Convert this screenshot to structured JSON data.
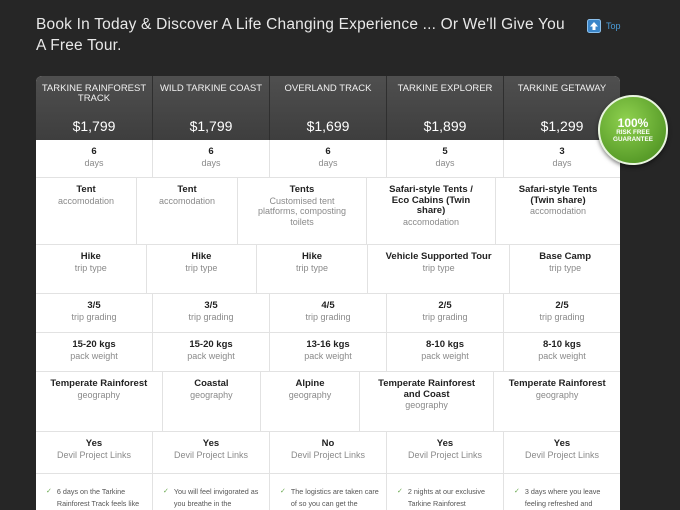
{
  "headline": "Book In Today & Discover A Life Changing Experience ... Or We'll Give You A Free Tour.",
  "top_link": {
    "label": "Top",
    "icon": "up-arrow-icon"
  },
  "badge": {
    "line1": "100%",
    "line2": "RISK FREE",
    "line3": "GUARANTEE",
    "color": "#6ab53a"
  },
  "tours": [
    {
      "name": "Tarkine Rainforest Track",
      "price": "$1,799",
      "days": "6",
      "days_label": "days",
      "accom": "Tent",
      "accom_label": "accomodation",
      "trip_type": "Hike",
      "trip_type_label": "trip type",
      "grading": "3/5",
      "grading_label": "trip grading",
      "pack": "15-20 kgs",
      "pack_label": "pack weight",
      "geography": "Temperate Rainforest",
      "geography_label": "geography",
      "devil": "Yes",
      "devil_label": "Devil Project Links",
      "desc": "6 days on the Tarkine Rainforest Track feels like"
    },
    {
      "name": "Wild Tarkine Coast",
      "price": "$1,799",
      "days": "6",
      "days_label": "days",
      "accom": "Tent",
      "accom_label": "accomodation",
      "trip_type": "Hike",
      "trip_type_label": "trip type",
      "grading": "3/5",
      "grading_label": "trip grading",
      "pack": "15-20 kgs",
      "pack_label": "pack weight",
      "geography": "Coastal",
      "geography_label": "geography",
      "devil": "Yes",
      "devil_label": "Devil Project Links",
      "desc": "You will feel invigorated as you breathe in the"
    },
    {
      "name": "Overland Track",
      "price": "$1,699",
      "days": "6",
      "days_label": "days",
      "accom": "Tents",
      "accom_label": "Customised tent platforms, composting toilets",
      "trip_type": "Hike",
      "trip_type_label": "trip type",
      "grading": "4/5",
      "grading_label": "trip grading",
      "pack": "13-16 kgs",
      "pack_label": "pack weight",
      "geography": "Alpine",
      "geography_label": "geography",
      "devil": "No",
      "devil_label": "Devil Project Links",
      "desc": "The logistics are taken care of so you can get the"
    },
    {
      "name": "Tarkine Explorer",
      "price": "$1,899",
      "days": "5",
      "days_label": "days",
      "accom": "Safari-style Tents / Eco Cabins (Twin share)",
      "accom_label": "accomodation",
      "trip_type": "Vehicle Supported Tour",
      "trip_type_label": "trip type",
      "grading": "2/5",
      "grading_label": "trip grading",
      "pack": "8-10 kgs",
      "pack_label": "pack weight",
      "geography": "Temperate Rainforest and Coast",
      "geography_label": "geography",
      "devil": "Yes",
      "devil_label": "Devil Project Links",
      "desc": "2 nights at our exclusive Tarkine Rainforest"
    },
    {
      "name": "Tarkine Getaway",
      "price": "$1,299",
      "days": "3",
      "days_label": "days",
      "accom": "Safari-style Tents (Twin share)",
      "accom_label": "accomodation",
      "trip_type": "Base Camp",
      "trip_type_label": "trip type",
      "grading": "2/5",
      "grading_label": "trip grading",
      "pack": "8-10 kgs",
      "pack_label": "pack weight",
      "geography": "Temperate Rainforest",
      "geography_label": "geography",
      "devil": "Yes",
      "devil_label": "Devil Project Links",
      "desc": "3 days where you leave feeling refreshed and"
    }
  ]
}
